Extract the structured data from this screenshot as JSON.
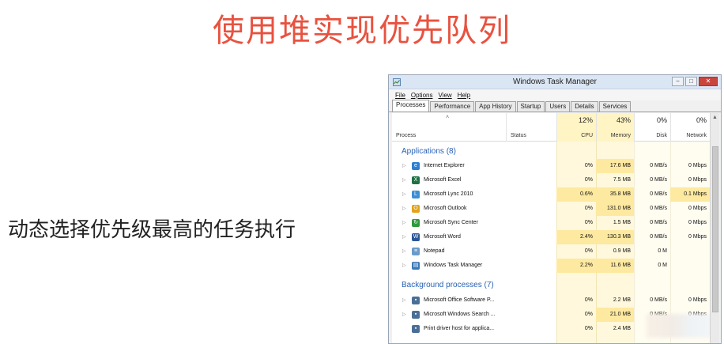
{
  "slide": {
    "title": "使用堆实现优先队列",
    "caption": "动态选择优先级最高的任务执行"
  },
  "window": {
    "title": "Windows Task Manager",
    "controls": {
      "minimize": "−",
      "maximize": "□",
      "close": "✕"
    }
  },
  "menu": [
    "File",
    "Options",
    "View",
    "Help"
  ],
  "tabs": [
    {
      "label": "Processes",
      "active": true
    },
    {
      "label": "Performance",
      "active": false
    },
    {
      "label": "App History",
      "active": false
    },
    {
      "label": "Startup",
      "active": false
    },
    {
      "label": "Users",
      "active": false
    },
    {
      "label": "Details",
      "active": false
    },
    {
      "label": "Services",
      "active": false
    }
  ],
  "columns": {
    "process": "Process",
    "status": "Status",
    "cpu": {
      "pct": "12%",
      "label": "CPU"
    },
    "memory": {
      "pct": "43%",
      "label": "Memory"
    },
    "disk": {
      "pct": "0%",
      "label": "Disk"
    },
    "network": {
      "pct": "0%",
      "label": "Network"
    }
  },
  "groups": {
    "applications": "Applications (8)",
    "background": "Background processes (7)"
  },
  "applications": [
    {
      "name": "Internet Explorer",
      "icon": "internet-explorer-icon",
      "color": "#2d7fd3",
      "glyph": "e",
      "cpu": "0%",
      "mem": "17.6 MB",
      "disk": "0 MB/s",
      "net": "0 Mbps",
      "hl_cpu": false,
      "hl_mem": true,
      "hl_net": false
    },
    {
      "name": "Microsoft Excel",
      "icon": "excel-icon",
      "color": "#1e7145",
      "glyph": "X",
      "cpu": "0%",
      "mem": "7.5 MB",
      "disk": "0 MB/s",
      "net": "0 Mbps",
      "hl_cpu": false,
      "hl_mem": false,
      "hl_net": false
    },
    {
      "name": "Microsoft Lync 2010",
      "icon": "lync-icon",
      "color": "#3a8fd6",
      "glyph": "L",
      "cpu": "0.6%",
      "mem": "35.8 MB",
      "disk": "0 MB/s",
      "net": "0.1 Mbps",
      "hl_cpu": true,
      "hl_mem": true,
      "hl_net": true
    },
    {
      "name": "Microsoft Outlook",
      "icon": "outlook-icon",
      "color": "#e3a21a",
      "glyph": "O",
      "cpu": "0%",
      "mem": "131.0 MB",
      "disk": "0 MB/s",
      "net": "0 Mbps",
      "hl_cpu": false,
      "hl_mem": true,
      "hl_net": false
    },
    {
      "name": "Microsoft Sync Center",
      "icon": "sync-center-icon",
      "color": "#2e9a3c",
      "glyph": "↻",
      "cpu": "0%",
      "mem": "1.5 MB",
      "disk": "0 MB/s",
      "net": "0 Mbps",
      "hl_cpu": false,
      "hl_mem": false,
      "hl_net": false
    },
    {
      "name": "Microsoft Word",
      "icon": "word-icon",
      "color": "#2b5797",
      "glyph": "W",
      "cpu": "2.4%",
      "mem": "130.3 MB",
      "disk": "0 MB/s",
      "net": "0 Mbps",
      "hl_cpu": true,
      "hl_mem": true,
      "hl_net": false
    },
    {
      "name": "Notepad",
      "icon": "notepad-icon",
      "color": "#6a9bc9",
      "glyph": "≡",
      "cpu": "0%",
      "mem": "0.9 MB",
      "disk": "0 M",
      "net": "",
      "hl_cpu": false,
      "hl_mem": false,
      "hl_net": false
    },
    {
      "name": "Windows Task Manager",
      "icon": "task-manager-icon",
      "color": "#3c78b4",
      "glyph": "▤",
      "cpu": "2.2%",
      "mem": "11.6 MB",
      "disk": "0 M",
      "net": "",
      "hl_cpu": true,
      "hl_mem": true,
      "hl_net": false
    }
  ],
  "background": [
    {
      "name": "Microsoft Office Software P...",
      "icon": "service-icon",
      "color": "#4a6f96",
      "glyph": "▪",
      "cpu": "0%",
      "mem": "2.2 MB",
      "disk": "0 MB/s",
      "net": "0 Mbps",
      "hl_cpu": false,
      "hl_mem": false,
      "hl_net": false,
      "expand": true
    },
    {
      "name": "Microsoft Windows Search ...",
      "icon": "service-icon",
      "color": "#4a6f96",
      "glyph": "▪",
      "cpu": "0%",
      "mem": "21.0 MB",
      "disk": "0 MB/s",
      "net": "0 Mbps",
      "hl_cpu": false,
      "hl_mem": true,
      "hl_net": false,
      "expand": true
    },
    {
      "name": "Print driver host for applica...",
      "icon": "service-icon",
      "color": "#4a6f96",
      "glyph": "▪",
      "cpu": "0%",
      "mem": "2.4 MB",
      "disk": "0 MB/s",
      "net": "0 Mbps",
      "hl_cpu": false,
      "hl_mem": false,
      "hl_net": false,
      "expand": false
    }
  ]
}
